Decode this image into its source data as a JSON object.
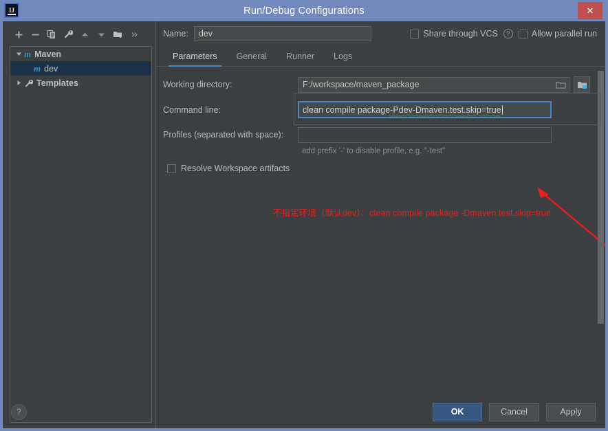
{
  "window": {
    "title": "Run/Debug Configurations",
    "logo_text": "IJ",
    "close_label": "✕"
  },
  "toolbar": {
    "items": [
      {
        "name": "add-button",
        "label": "+"
      },
      {
        "name": "remove-button",
        "label": "−"
      },
      {
        "name": "copy-button",
        "label": "copy"
      },
      {
        "name": "edit-templates-button",
        "label": "wrench"
      },
      {
        "name": "move-up-button",
        "label": "▲"
      },
      {
        "name": "move-down-button",
        "label": "▼"
      },
      {
        "name": "new-folder-button",
        "label": "folder-plus"
      },
      {
        "name": "more-button",
        "label": "»"
      }
    ]
  },
  "tree": {
    "nodes": [
      {
        "label": "Maven",
        "icon": "m",
        "expanded": true,
        "selected": false,
        "indent": false
      },
      {
        "label": "dev",
        "icon": "m",
        "expanded": false,
        "selected": true,
        "indent": true
      },
      {
        "label": "Templates",
        "icon": "wrench",
        "expanded": false,
        "selected": false,
        "indent": false
      }
    ]
  },
  "help": {
    "label": "?"
  },
  "name": {
    "label": "Name:",
    "value": "dev",
    "placeholder": ""
  },
  "options": {
    "share_label": "Share through VCS",
    "share_checked": false,
    "share_help": "?",
    "parallel_label": "Allow parallel run",
    "parallel_checked": false
  },
  "tabs": [
    {
      "label": "Parameters",
      "active": true
    },
    {
      "label": "General",
      "active": false
    },
    {
      "label": "Runner",
      "active": false
    },
    {
      "label": "Logs",
      "active": false
    }
  ],
  "form": {
    "working_directory": {
      "label": "Working directory:",
      "value": "F:/workspace/maven_package",
      "browse_icon": "folder-icon",
      "module_icon": "folder-module-icon"
    },
    "command_line": {
      "label": "Command line:",
      "value": "clean compile package -Pdev -Dmaven.test.skip=true",
      "value_plain": "clean compile package ",
      "value_flag1": "-Pdev",
      "value_sep": " ",
      "value_flag2": "-Dmaven.test.skip=true",
      "focused": true
    },
    "profiles": {
      "label": "Profiles (separated with space):",
      "value": "",
      "hint": "add prefix '-' to disable profile, e.g. \"-test\""
    },
    "resolve_workspace": {
      "label": "Resolve Workspace artifacts",
      "checked": false
    }
  },
  "annotation": {
    "text": "不指定环境（默认dev）：clean compile package  -Dmaven.test.skip=true",
    "color": "#ee1c1c"
  },
  "footer": {
    "ok": "OK",
    "cancel": "Cancel",
    "apply": "Apply"
  },
  "colors": {
    "titlebar": "#7289bd",
    "panel": "#3c3f41",
    "accent": "#4a88c7",
    "primary_button": "#365880",
    "annotation": "#ee1c1c",
    "selection": "#1b3147",
    "maven_icon": "#3592c4"
  }
}
